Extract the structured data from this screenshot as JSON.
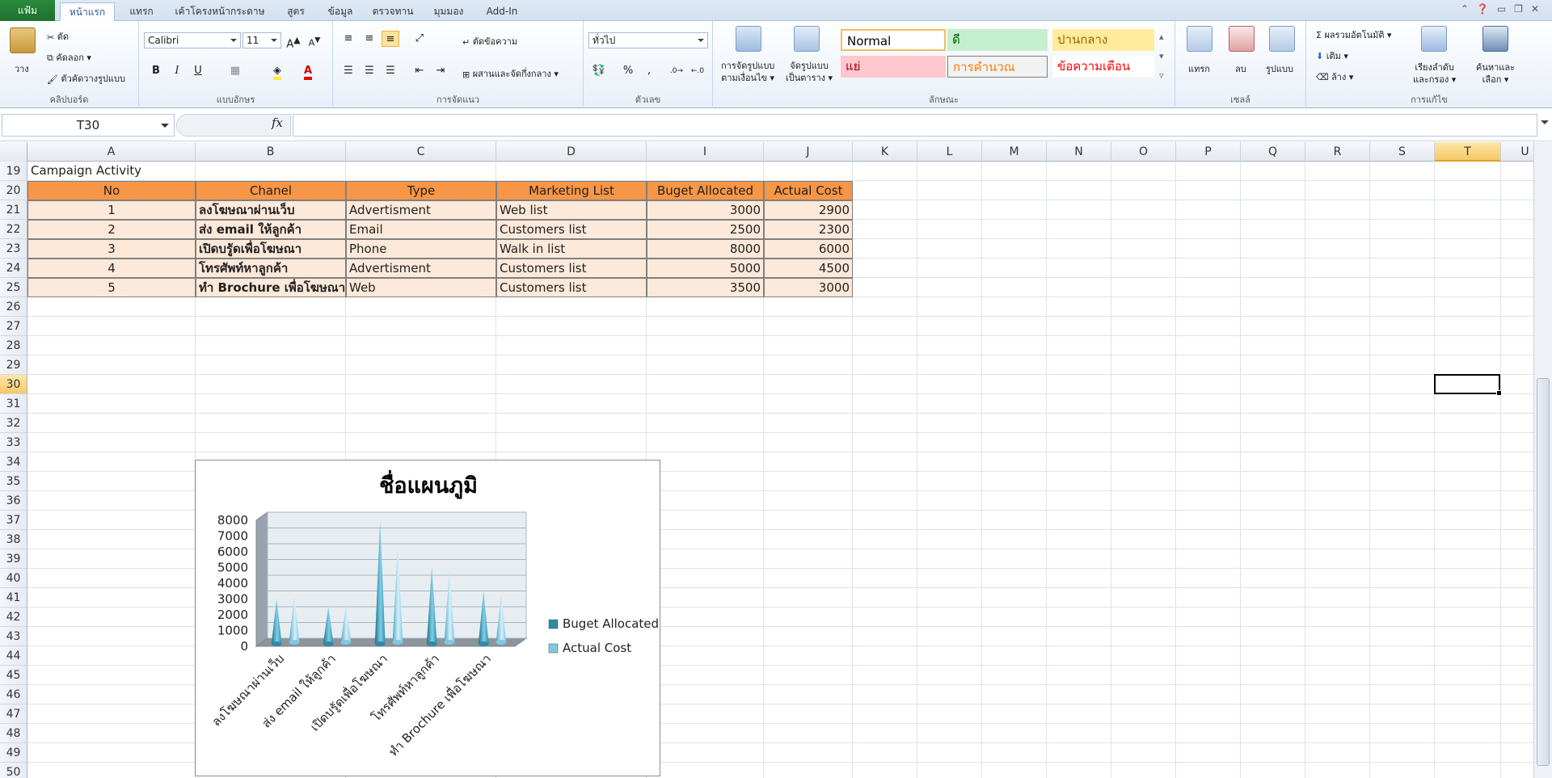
{
  "ribbon": {
    "file_tab": "แฟ้ม",
    "tabs": [
      "หน้าแรก",
      "แทรก",
      "เค้าโครงหน้ากระดาษ",
      "สูตร",
      "ข้อมูล",
      "ตรวจทาน",
      "มุมมอง",
      "Add-In"
    ],
    "active_tab": "หน้าแรก",
    "clipboard": {
      "paste": "วาง",
      "cut": "ตัด",
      "copy": "คัดลอก",
      "format_painter": "ตัวคัดวางรูปแบบ",
      "label": "คลิปบอร์ด"
    },
    "font": {
      "name": "Calibri",
      "size": "11",
      "bold": "B",
      "italic": "I",
      "underline": "U",
      "label": "แบบอักษร"
    },
    "alignment": {
      "wrap": "ตัดข้อความ",
      "merge": "ผสานและจัดกึ่งกลาง",
      "label": "การจัดแนว"
    },
    "number": {
      "format": "ทั่วไป",
      "percent": "%",
      "comma": ",",
      "label": "ตัวเลข"
    },
    "styles": {
      "conditional": "การจัดรูปแบบ",
      "conditional2": "ตามเงื่อนไข",
      "as_table": "จัดรูปแบบ",
      "as_table2": "เป็นตาราง",
      "normal": "Normal",
      "good": "ดี",
      "neutral": "ปานกลาง",
      "bad": "แย่",
      "calc": "การคำนวณ",
      "warning": "ข้อความเตือน",
      "label": "ลักษณะ"
    },
    "cells": {
      "insert": "แทรก",
      "delete": "ลบ",
      "format": "รูปแบบ",
      "label": "เซลล์"
    },
    "editing": {
      "autosum": "ผลรวมอัตโนมัติ",
      "fill": "เติม",
      "clear": "ล้าง",
      "sort": "เรียงลำดับ",
      "sort2": "และกรอง",
      "find": "ค้นหาและ",
      "find2": "เลือก",
      "label": "การแก้ไข"
    }
  },
  "formula_bar": {
    "name_box": "T30",
    "fx": "fx",
    "value": ""
  },
  "columns": [
    "A",
    "B",
    "C",
    "D",
    "I",
    "J",
    "K",
    "L",
    "M",
    "N",
    "O",
    "P",
    "Q",
    "R",
    "S",
    "T",
    "U"
  ],
  "selected_column": "T",
  "rows": [
    "19",
    "20",
    "21",
    "22",
    "23",
    "24",
    "25",
    "26",
    "27",
    "28",
    "29",
    "30",
    "31",
    "32",
    "33",
    "34",
    "35",
    "36",
    "37",
    "38",
    "39",
    "40",
    "41",
    "42",
    "43",
    "44",
    "45",
    "46",
    "47",
    "48",
    "49",
    "50"
  ],
  "selected_row": "30",
  "sheet": {
    "title": "Campaign Activity",
    "headers": [
      "No",
      "Chanel",
      "Type",
      "Marketing List",
      "Buget Allocated",
      "Actual Cost"
    ],
    "data": [
      [
        "1",
        "ลงโฆษณาผ่านเว็บ",
        "Advertisment",
        "Web list",
        "3000",
        "2900"
      ],
      [
        "2",
        "ส่ง email ให้ลูกค้า",
        "Email",
        "Customers list",
        "2500",
        "2300"
      ],
      [
        "3",
        "เปิดบรูัดเพื่อโฆษณา",
        "Phone",
        "Walk in list",
        "8000",
        "6000"
      ],
      [
        "4",
        "โทรศัพท์หาลูกค้า",
        "Advertisment",
        "Customers list",
        "5000",
        "4500"
      ],
      [
        "5",
        "ทำ Brochure เพื่อโฆษณา",
        "Web",
        "Customers list",
        "3500",
        "3000"
      ]
    ]
  },
  "chart_data": {
    "type": "bar",
    "title": "ชื่อแผนภูมิ",
    "categories": [
      "ลงโฆษณาผ่านเว็บ",
      "ส่ง email ให้ลูกค้า",
      "เปิดบรูัดเพื่อโฆษณา",
      "โทรศัพท์หาลูกค้า",
      "ทำ Brochure เพื่อโฆษณา"
    ],
    "series": [
      {
        "name": "Buget Allocated",
        "values": [
          3000,
          2500,
          8000,
          5000,
          3500
        ],
        "color": "#2f8aa6"
      },
      {
        "name": "Actual Cost",
        "values": [
          2900,
          2300,
          6000,
          4500,
          3000
        ],
        "color": "#7fc8e0"
      }
    ],
    "yticks": [
      "0",
      "1000",
      "2000",
      "3000",
      "4000",
      "5000",
      "6000",
      "7000",
      "8000"
    ],
    "ylim": [
      0,
      8000
    ],
    "legend": "right",
    "grid": true
  }
}
